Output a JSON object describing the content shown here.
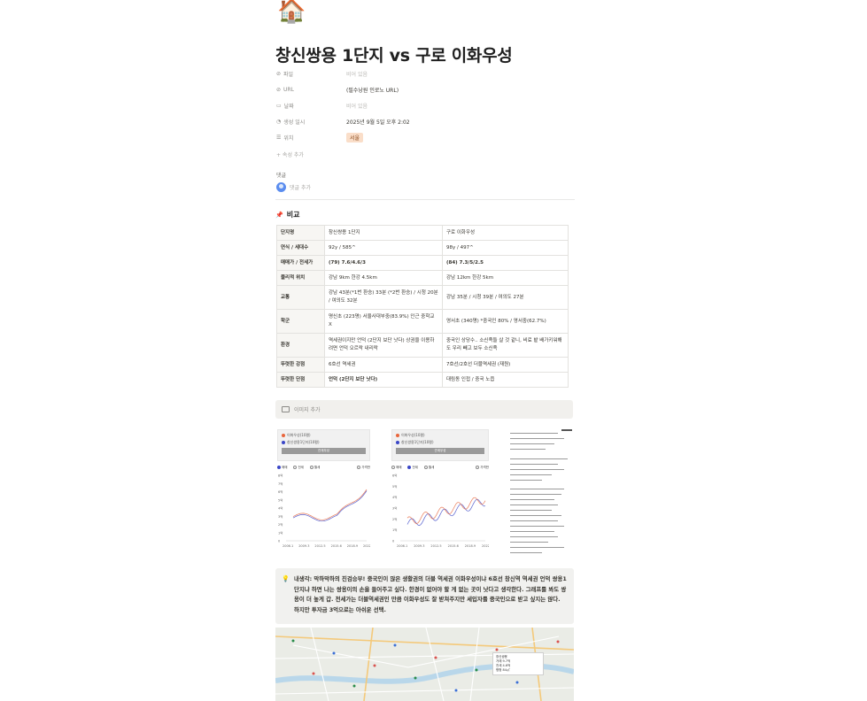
{
  "page": {
    "icon": "🏠",
    "title": "창신쌍용 1단지 vs 구로 이화우성"
  },
  "properties": [
    {
      "icon": "paperclip-icon",
      "glyph": "🔗",
      "label": "파일",
      "value": "비어 있음",
      "empty": true
    },
    {
      "icon": "link-icon",
      "glyph": "🔗",
      "label": "URL",
      "value": "(필수낭원 인로노 URL)",
      "empty": false
    },
    {
      "icon": "calendar-icon",
      "glyph": "📅",
      "label": "날짜",
      "value": "비어 있음",
      "empty": true
    },
    {
      "icon": "clock-icon",
      "glyph": "🕓",
      "label": "생성 일시",
      "value": "2025년 9월 5일 오후 2:02",
      "empty": false
    },
    {
      "icon": "list-icon",
      "glyph": "☰",
      "label": "위치",
      "value": "서울",
      "tag": true
    }
  ],
  "add_property": "+ 속성 추가",
  "comments": {
    "label": "댓글",
    "placeholder": "댓글 추가"
  },
  "section": {
    "title": "비교"
  },
  "table": {
    "rows": [
      {
        "label": "단지명",
        "a": "창신쌍용 1단지",
        "b": "구로 이화우성"
      },
      {
        "label": "연식 / 세대수",
        "a": "92y / 585^",
        "b": "98y / 497^"
      },
      {
        "label": "매매가 / 전세가",
        "a": "(79) 7.6/4.6/3",
        "b": "(84) 7.3/5/2.5",
        "bold": true
      },
      {
        "label": "물리적 위치",
        "a": "강남 9km 한강 4.5km",
        "b": "강남 12km 한강 5km"
      },
      {
        "label": "교통",
        "a": "강남 43분(*1번 환승) 33분 (*2번 환승) / 시청 20분 / 여의도 32분",
        "b": "강남 35분 / 시청 39분 / 여의도 27분"
      },
      {
        "label": "학군",
        "a": "명신초 (223명) 서울사대부중(83.9%) 인근 중학교 X",
        "b": "영서초 (340명) *중국인 80% / 영서중(62.7%)"
      },
      {
        "label": "환경",
        "a": "역세권이지만 언덕 (2단지 보단 낫다) 상권을 이용하려면 언덕 오르락 내리락",
        "b": "중국인 상당수.. 소신족들 살 것 같니, 비료 밭 배가키워해도 우리 빼고 보두 소신족"
      },
      {
        "label": "뚜렷한 강점",
        "a": "6호선 역세권",
        "b": "7호선/2호선 더블역세권 (재원)"
      },
      {
        "label": "뚜렷한 단점",
        "a": "언덕 (2단지 보단 낫다)",
        "b": "대림동 인접 / 중국 노읍",
        "a_bold": true
      }
    ]
  },
  "image_add": "이미지 추가",
  "charts": [
    {
      "legend": [
        "이화우성(10평)",
        "창신쌍용1단지(10평)"
      ],
      "button": "관계우성",
      "tabs": [
        "매매",
        "전세",
        "월세",
        "가격만"
      ],
      "x_labels": [
        "2006.1",
        "2009.3",
        "2012.5",
        "2015.6",
        "2018.9",
        "2022.7"
      ],
      "y_labels": [
        "8억",
        "7억",
        "6억",
        "5억",
        "4억",
        "3억",
        "2억",
        "1억",
        "0"
      ],
      "tab_on": 0
    },
    {
      "legend": [
        "이화우성(10평)",
        "창신쌍용1단지(10평)"
      ],
      "button": "관계우성",
      "tabs": [
        "매매",
        "전세",
        "월세",
        "가격만"
      ],
      "x_labels": [
        "2006.1",
        "2009.3",
        "2012.5",
        "2015.6",
        "2018.9",
        "2022.7"
      ],
      "y_labels": [
        "6억",
        "5억",
        "4억",
        "3억",
        "2억",
        "1억",
        "0"
      ],
      "tab_on": 1
    }
  ],
  "callout": {
    "text": "내생각: 막하막하의 진검승부! 중국인이 많은 생활권의 더블 역세권 이화우성이냐 6호선 창신역 역세권 언덕 쌍용1단지냐 하면 나는 쌍용이의 손을 들어주고 싶다. 한경이 없어야 할 게 없는 곳이 낫다고 생각한다. 그래프를 봐도 쌍용이 더 높게 갑. 전세가는 더블역세권인 만큼 이화우성도 잘 받쳐주지만 세입자를 중국인으로 받고 싶지는 않다. 하지만 투자금 3억으로는 아쉬운 선택."
  },
  "map": {
    "popup": [
      "창신쌍용",
      "거래 9.7억",
      "전세 4.6억",
      "평형 84㎡"
    ]
  },
  "colors": {
    "series_a": "#e8663d",
    "series_b": "#3b47c7",
    "tag_bg": "#fadec9",
    "callout_bg": "#f1f1ef"
  }
}
